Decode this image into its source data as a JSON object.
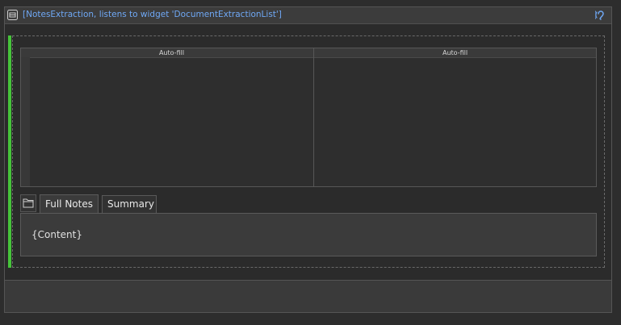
{
  "widget": {
    "title": "[NotesExtraction, listens to widget 'DocumentExtractionList']",
    "header_icon": "widget-icon",
    "listen_icon": "listen-ear-icon",
    "accent_color": "#46c43a",
    "title_color": "#6fa8f5"
  },
  "grid": {
    "columns": [
      {
        "header": "Auto-fill"
      },
      {
        "header": "Auto-fill"
      }
    ]
  },
  "tabs": {
    "icon": "folder-icon",
    "items": [
      {
        "label": "Full Notes",
        "active": true
      },
      {
        "label": "Summary",
        "active": false
      }
    ]
  },
  "content": {
    "text": "{Content}"
  }
}
